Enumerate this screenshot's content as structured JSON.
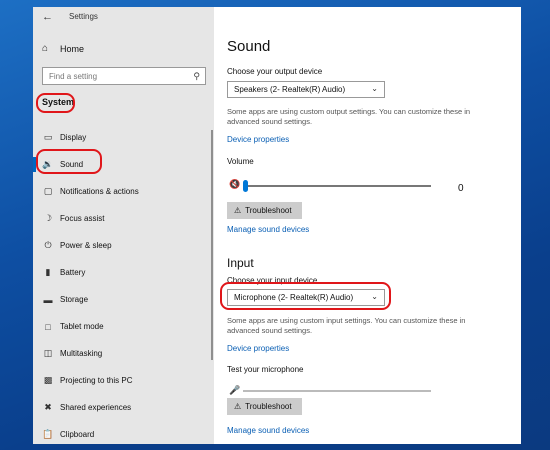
{
  "window": {
    "title": "Settings"
  },
  "sidebar": {
    "home": {
      "label": "Home",
      "icon": "home-icon"
    },
    "search": {
      "placeholder": "Find a setting",
      "icon": "search-icon"
    },
    "section": "System",
    "items": [
      {
        "label": "Display",
        "icon": "display-icon",
        "active": false
      },
      {
        "label": "Sound",
        "icon": "speaker-icon",
        "active": true
      },
      {
        "label": "Notifications & actions",
        "icon": "notifications-icon",
        "active": false
      },
      {
        "label": "Focus assist",
        "icon": "moon-icon",
        "active": false
      },
      {
        "label": "Power & sleep",
        "icon": "power-icon",
        "active": false
      },
      {
        "label": "Battery",
        "icon": "battery-icon",
        "active": false
      },
      {
        "label": "Storage",
        "icon": "storage-icon",
        "active": false
      },
      {
        "label": "Tablet mode",
        "icon": "tablet-icon",
        "active": false
      },
      {
        "label": "Multitasking",
        "icon": "multitasking-icon",
        "active": false
      },
      {
        "label": "Projecting to this PC",
        "icon": "projecting-icon",
        "active": false
      },
      {
        "label": "Shared experiences",
        "icon": "shared-icon",
        "active": false
      },
      {
        "label": "Clipboard",
        "icon": "clipboard-icon",
        "active": false
      }
    ]
  },
  "main": {
    "title": "Sound",
    "output": {
      "label": "Choose your output device",
      "device": "Speakers (2- Realtek(R) Audio)",
      "note": "Some apps are using custom output settings. You can customize these in advanced sound settings.",
      "properties_link": "Device properties",
      "volume_label": "Volume",
      "volume_value": "0",
      "volume_level": 0.0,
      "troubleshoot": "Troubleshoot",
      "manage_link": "Manage sound devices"
    },
    "input": {
      "heading": "Input",
      "label": "Choose your input device",
      "device": "Microphone (2- Realtek(R) Audio)",
      "note": "Some apps are using custom input settings. You can customize these in advanced sound settings.",
      "properties_link": "Device properties",
      "test_label": "Test your microphone",
      "mic_level": 0.0,
      "troubleshoot": "Troubleshoot",
      "manage_link": "Manage sound devices"
    }
  },
  "colors": {
    "accent": "#0078d7",
    "highlight": "#e0161a",
    "link": "#0a5fb4"
  }
}
